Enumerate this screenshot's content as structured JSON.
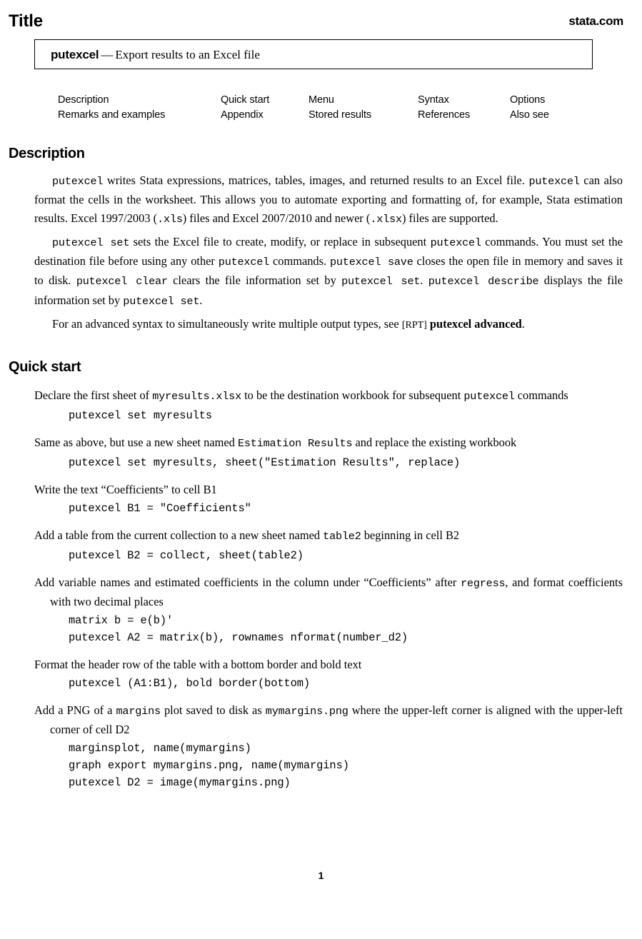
{
  "header": {
    "title": "Title",
    "site_link": "stata.com"
  },
  "title_box": {
    "command": "putexcel",
    "dash": "—",
    "description": "Export results to an Excel file"
  },
  "nav_links": {
    "columns": [
      {
        "items": [
          "Description",
          "Remarks and examples"
        ]
      },
      {
        "items": [
          "Quick start",
          "Appendix"
        ]
      },
      {
        "items": [
          "Menu",
          "Stored results"
        ]
      },
      {
        "items": [
          "Syntax",
          "References"
        ]
      },
      {
        "items": [
          "Options",
          "Also see"
        ]
      }
    ]
  },
  "sections": {
    "description": {
      "heading": "Description",
      "paragraphs": {
        "p1": {
          "s1": "putexcel",
          "s2": " writes Stata expressions, matrices, tables, images, and returned results to an Excel file. ",
          "s3": "putexcel",
          "s4": " can also format the cells in the worksheet. This allows you to automate exporting and formatting of, for example, Stata estimation results. Excel 1997/2003 (",
          "s5": ".xls",
          "s6": ") files and Excel 2007/2010 and newer (",
          "s7": ".xlsx",
          "s8": ") files are supported."
        },
        "p2": {
          "s1": "putexcel set",
          "s2": " sets the Excel file to create, modify, or replace in subsequent ",
          "s3": "putexcel",
          "s4": " commands. You must set the destination file before using any other ",
          "s5": "putexcel",
          "s6": " commands. ",
          "s7": "putexcel save",
          "s8": " closes the open file in memory and saves it to disk. ",
          "s9": "putexcel clear",
          "s10": " clears the file information set by ",
          "s11": "putexcel set",
          "s12": ". ",
          "s13": "putexcel describe",
          "s14": " displays the file information set by ",
          "s15": "putexcel set",
          "s16": "."
        },
        "p3": {
          "s1": "For an advanced syntax to simultaneously write multiple output types, see ",
          "s2": "[RPT]",
          "s3": " ",
          "s4": "putexcel advanced",
          "s5": "."
        }
      }
    },
    "quick_start": {
      "heading": "Quick start",
      "entries": [
        {
          "desc": {
            "s1": "Declare the first sheet of ",
            "s2": "myresults.xlsx",
            "s3": " to be the destination workbook for subsequent ",
            "s4": "putexcel",
            "s5": " commands"
          },
          "code": "putexcel set myresults"
        },
        {
          "desc": {
            "s1": "Same as above, but use a new sheet named ",
            "s2": "Estimation Results",
            "s3": " and replace the existing workbook",
            "s4": "",
            "s5": ""
          },
          "code": "putexcel set myresults, sheet(\"Estimation Results\", replace)"
        },
        {
          "desc": {
            "s1": "Write the text “Coefficients” to cell B1",
            "s2": "",
            "s3": "",
            "s4": "",
            "s5": ""
          },
          "code": "putexcel B1 = \"Coefficients\""
        },
        {
          "desc": {
            "s1": "Add a table from the current collection to a new sheet named ",
            "s2": "table2",
            "s3": " beginning in cell B2",
            "s4": "",
            "s5": ""
          },
          "code": "putexcel B2 = collect, sheet(table2)"
        },
        {
          "desc": {
            "s1": "Add variable names and estimated coefficients in the column under “Coefficients” after ",
            "s2": "regress",
            "s3": ", and format coefficients with two decimal places",
            "s4": "",
            "s5": ""
          },
          "code": "matrix b = e(b)'\nputexcel A2 = matrix(b), rownames nformat(number_d2)"
        },
        {
          "desc": {
            "s1": "Format the header row of the table with a bottom border and bold text",
            "s2": "",
            "s3": "",
            "s4": "",
            "s5": ""
          },
          "code": "putexcel (A1:B1), bold border(bottom)"
        },
        {
          "desc": {
            "s1": "Add a PNG of a ",
            "s2": "margins",
            "s3": " plot saved to disk as ",
            "s4": "mymargins.png",
            "s5": " where the upper-left corner is aligned with the upper-left corner of cell D2"
          },
          "code": "marginsplot, name(mymargins)\ngraph export mymargins.png, name(mymargins)\nputexcel D2 = image(mymargins.png)"
        }
      ]
    }
  },
  "footer": {
    "page_number": "1"
  }
}
